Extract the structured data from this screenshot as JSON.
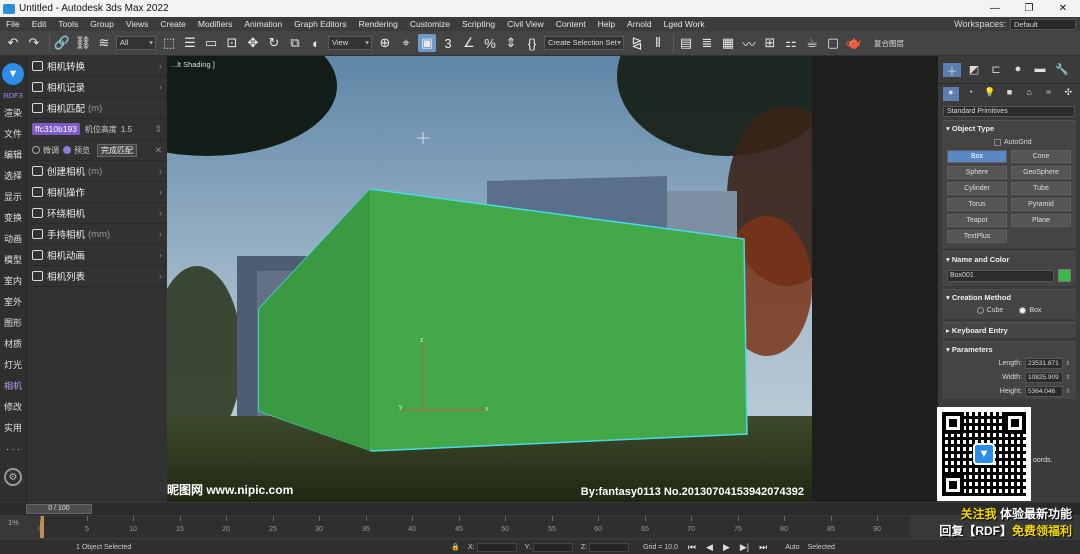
{
  "window": {
    "title": "Untitled - Autodesk 3ds Max 2022",
    "controls": [
      "—",
      "❐",
      "✕"
    ]
  },
  "menu": {
    "items": [
      "File",
      "Edit",
      "Tools",
      "Group",
      "Views",
      "Create",
      "Modifiers",
      "Animation",
      "Graph Editors",
      "Rendering",
      "Customize",
      "Scripting",
      "Civil View",
      "Content",
      "Help",
      "Arnold",
      "Lged Work"
    ],
    "workspace_label": "Workspaces:",
    "workspace_value": "Default"
  },
  "toolbar": {
    "filter_value": "All",
    "view_value": "View",
    "selection_set_placeholder": "Create Selection Set",
    "right_text": "复合图层"
  },
  "left_strip": {
    "rdf_label": "RDF3",
    "items": [
      "渲染",
      "文件",
      "编辑",
      "选择",
      "显示",
      "变换",
      "动画",
      "模型",
      "室内",
      "室外",
      "图形",
      "材质",
      "灯光",
      "相机",
      "修改",
      "实用"
    ],
    "more": "· · ·"
  },
  "plugin": {
    "rows": [
      "相机转换",
      "相机记录",
      "相机匹配"
    ],
    "match_hint": "(m)",
    "tag": "ffc310b193",
    "height_label": "机位高度",
    "height_value": "1.5",
    "opt_fine": "微调",
    "opt_preview": "预览",
    "done_button": "完成匹配",
    "create_label": "创建相机",
    "create_hint": "(m)",
    "rows2": [
      "相机操作",
      "环绕相机"
    ],
    "handheld_label": "手持相机",
    "handheld_hint": "(mm)",
    "rows3": [
      "相机动画",
      "相机列表"
    ]
  },
  "viewport": {
    "label": "...lt Shading ]",
    "watermark": "昵图网 www.nipic.com",
    "signature": "By:fantasy0113  No.20130704153942074392",
    "axis_z": "z",
    "axis_y": "y",
    "axis_x": "x"
  },
  "command_panel": {
    "category_dropdown": "Standard Primitives",
    "object_type_title": "Object Type",
    "autogrid_label": "AutoGrid",
    "object_buttons": [
      "Box",
      "Cone",
      "Sphere",
      "GeoSphere",
      "Cylinder",
      "Tube",
      "Torus",
      "Pyramid",
      "Teapot",
      "Plane",
      "TextPlus"
    ],
    "name_color_title": "Name and Color",
    "object_name": "Box001",
    "object_color": "#3db84a",
    "creation_method_title": "Creation Method",
    "method_cube": "Cube",
    "method_box": "Box",
    "keyboard_entry_title": "Keyboard Entry",
    "parameters_title": "Parameters",
    "length_label": "Length:",
    "length_value": "23531.871",
    "width_label": "Width:",
    "width_value": "10825.909",
    "height_label": "Height:",
    "height_value": "5364.046",
    "extra_text": "oords."
  },
  "timeline": {
    "frame_slider": "0 / 100",
    "percent": "1%",
    "ticks": [
      "0",
      "5",
      "10",
      "15",
      "20",
      "25",
      "30",
      "35",
      "40",
      "45",
      "50",
      "55",
      "60",
      "65",
      "70",
      "75",
      "80",
      "85",
      "90"
    ]
  },
  "status": {
    "selected": "1 Object Selected",
    "x_label": "X:",
    "y_label": "Y:",
    "z_label": "Z:",
    "grid": "Grid = 10.0",
    "auto_label": "Auto",
    "selected_label": "Selected"
  },
  "promo": {
    "line1_a": "关注我",
    "line1_b": "体验最新功能",
    "line2_a": "回复【RDF】",
    "line2_b": "免费领福利"
  }
}
